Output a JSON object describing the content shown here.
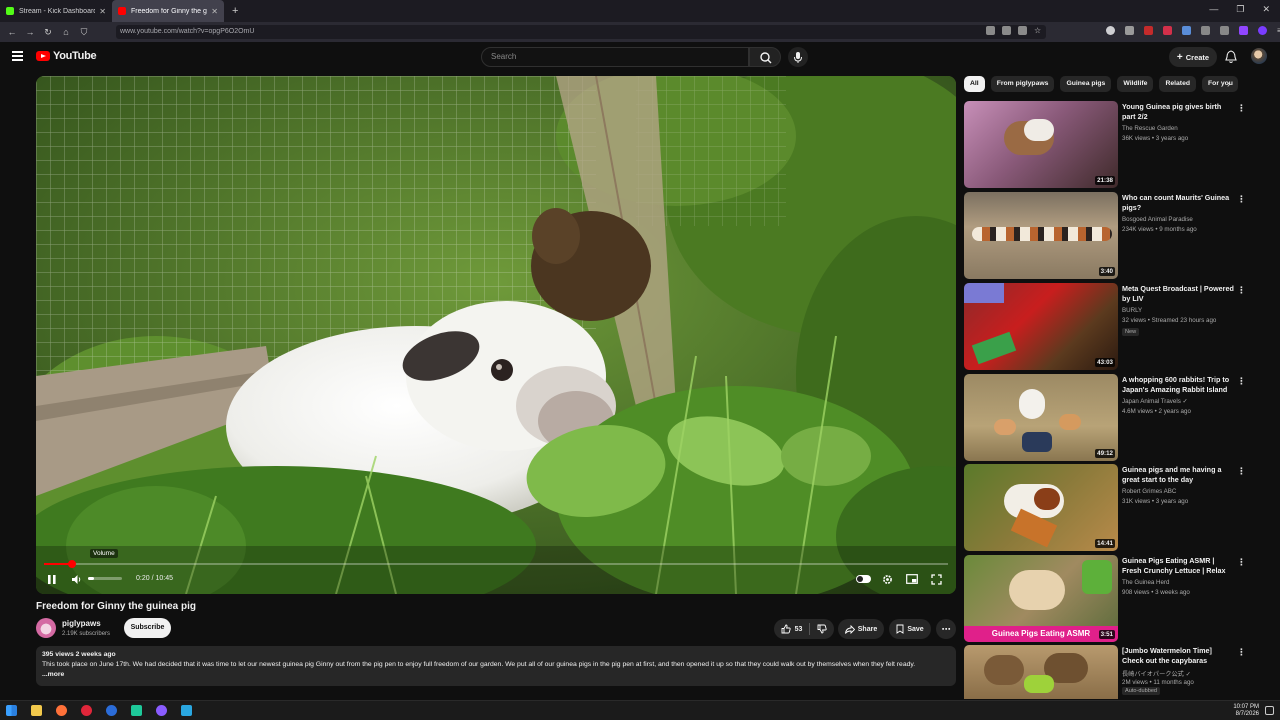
{
  "browser": {
    "tabs": [
      {
        "title": "Stream - Kick Dashboard",
        "color": "#53fc18"
      },
      {
        "title": "Freedom for Ginny the guin",
        "color": "#ff0000"
      }
    ],
    "url": "www.youtube.com/watch?v=opgP6O2OmU"
  },
  "header": {
    "logo_text": "YouTube",
    "search_placeholder": "Search",
    "create_label": "Create"
  },
  "player": {
    "time_current": "0:20",
    "time_total": "10:45",
    "time_display": "0:20 / 10:45",
    "progress_fraction": 0.031,
    "tooltip": "Volume"
  },
  "video": {
    "title": "Freedom for Ginny the guinea pig",
    "channel": "piglypaws",
    "subscribers": "2.19K subscribers",
    "subscribe_label": "Subscribe",
    "likes": "53",
    "share_label": "Share",
    "save_label": "Save",
    "description_meta": "395 views  2 weeks ago",
    "description": "This took place on June 17th. We had decided that it was time to let our newest guinea pig Ginny out from the pig pen to enjoy full freedom of our garden. We put all of our guinea pigs in the pig pen at first, and then opened it up so that they could walk out by themselves when they felt ready.",
    "more_label": "...more"
  },
  "sidebar": {
    "chips": [
      "All",
      "From piglypaws",
      "Guinea pigs",
      "Wildlife",
      "Related",
      "For you"
    ],
    "recommendations": [
      {
        "title": "Young Guinea pig gives birth part 2/2",
        "channel": "The Rescue Garden",
        "meta": "36K views • 3 years ago",
        "duration": "21:38",
        "badge": ""
      },
      {
        "title": "Who can count Maurits' Guinea pigs?",
        "channel": "Bosgoed Animal Paradise",
        "meta": "234K views • 9 months ago",
        "duration": "3:40",
        "badge": ""
      },
      {
        "title": "Meta Quest Broadcast | Powered by LIV",
        "channel": "BURLY",
        "meta": "32 views • Streamed 23 hours ago",
        "duration": "43:03",
        "badge": "New"
      },
      {
        "title": "A whopping 600 rabbits! Trip to Japan's Amazing Rabbit Island 🐰",
        "channel": "Japan Animal Travels ✓",
        "meta": "4.6M views • 2 years ago",
        "duration": "49:12",
        "badge": ""
      },
      {
        "title": "Guinea pigs and me having a great start to the day",
        "channel": "Robert Grimes ABC",
        "meta": "31K views • 3 years ago",
        "duration": "14:41",
        "badge": ""
      },
      {
        "title": "Guinea Pigs Eating ASMR | Fresh Crunchy Lettuce | Relax with our ...",
        "channel": "The Guinea Herd",
        "meta": "908 views • 3 weeks ago",
        "duration": "3:51",
        "badge": "",
        "overlay": "Guinea Pigs Eating ASMR"
      },
      {
        "title": "[Jumbo Watermelon Time] Check out the capybaras flocking to eat ...",
        "channel": "長崎バイオパーク公式 ✓",
        "meta": "2M views • 11 months ago",
        "duration": "",
        "badge": "Auto-dubbed"
      }
    ]
  },
  "taskbar": {
    "time": "10:07 PM",
    "date": "8/7/2026"
  }
}
